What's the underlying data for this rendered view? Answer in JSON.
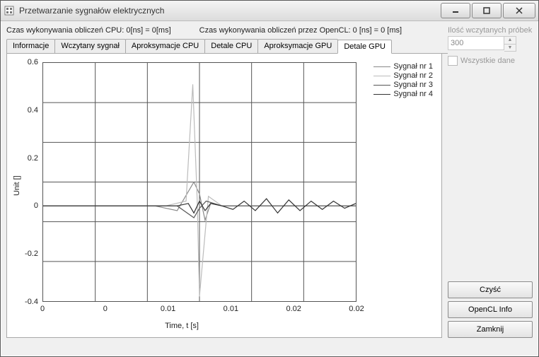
{
  "window": {
    "title": "Przetwarzanie sygnałów elektrycznych"
  },
  "status": {
    "cpu": "Czas wykonywania obliczeń CPU: 0[ns] = 0[ms]",
    "opencl": "Czas wykonywania obliczeń przez OpenCL: 0 [ns] = 0 [ms]"
  },
  "tabs": {
    "t0": "Informacje",
    "t1": "Wczytany sygnał",
    "t2": "Aproksymacje CPU",
    "t3": "Detale CPU",
    "t4": "Aproksymacje GPU",
    "t5": "Detale GPU"
  },
  "right": {
    "samples_label": "Ilość wczytanych próbek",
    "samples_value": "300",
    "all_data_label": "Wszystkie dane"
  },
  "buttons": {
    "clear": "Czyść",
    "opencl_info": "OpenCL Info",
    "close": "Zamknij"
  },
  "chart_data": {
    "type": "line",
    "xlabel": "Time, t [s]",
    "ylabel": "Unit []",
    "xlim": [
      0,
      0.028
    ],
    "ylim": [
      -0.4,
      0.6
    ],
    "xticks": [
      0,
      0,
      0.01,
      0.01,
      0.02,
      0.02
    ],
    "yticks": [
      -0.4,
      -0.2,
      0,
      0.2,
      0.4,
      0.6
    ],
    "legend": [
      "Sygnał nr 1",
      "Sygnał nr 2",
      "Sygnał nr 3",
      "Sygnał nr 4"
    ],
    "legend_colors": [
      "#888888",
      "#bbbbbb",
      "#555555",
      "#333333"
    ],
    "series": [
      {
        "name": "Sygnał nr 1",
        "color": "#888888",
        "x": [
          0,
          0.01,
          0.012,
          0.0135,
          0.014,
          0.0145,
          0.015,
          0.016,
          0.028
        ],
        "y": [
          0,
          0,
          -0.02,
          0.1,
          0.05,
          -0.06,
          0.01,
          0,
          0
        ]
      },
      {
        "name": "Sygnał nr 2",
        "color": "#bbbbbb",
        "x": [
          0,
          0.011,
          0.0128,
          0.0134,
          0.0138,
          0.014,
          0.0148,
          0.016,
          0.028
        ],
        "y": [
          0,
          0,
          0.02,
          0.51,
          0.02,
          -0.38,
          0.04,
          0,
          0
        ]
      },
      {
        "name": "Sygnał nr 3",
        "color": "#555555",
        "x": [
          0,
          0.012,
          0.0135,
          0.014,
          0.0146,
          0.016,
          0.028
        ],
        "y": [
          0,
          0,
          -0.05,
          -0.01,
          0.02,
          0,
          0
        ]
      },
      {
        "name": "Sygnał nr 4",
        "color": "#333333",
        "x": [
          0,
          0.002,
          0.006,
          0.012,
          0.013,
          0.0135,
          0.014,
          0.0145,
          0.015,
          0.016,
          0.017,
          0.018,
          0.019,
          0.02,
          0.021,
          0.022,
          0.023,
          0.024,
          0.025,
          0.026,
          0.027,
          0.028
        ],
        "y": [
          0,
          0,
          0,
          0,
          0.01,
          -0.03,
          0.02,
          -0.02,
          0.01,
          0.0,
          -0.015,
          0.02,
          -0.02,
          0.03,
          -0.03,
          0.025,
          -0.02,
          0.02,
          -0.015,
          0.02,
          -0.01,
          0.01
        ]
      }
    ]
  }
}
